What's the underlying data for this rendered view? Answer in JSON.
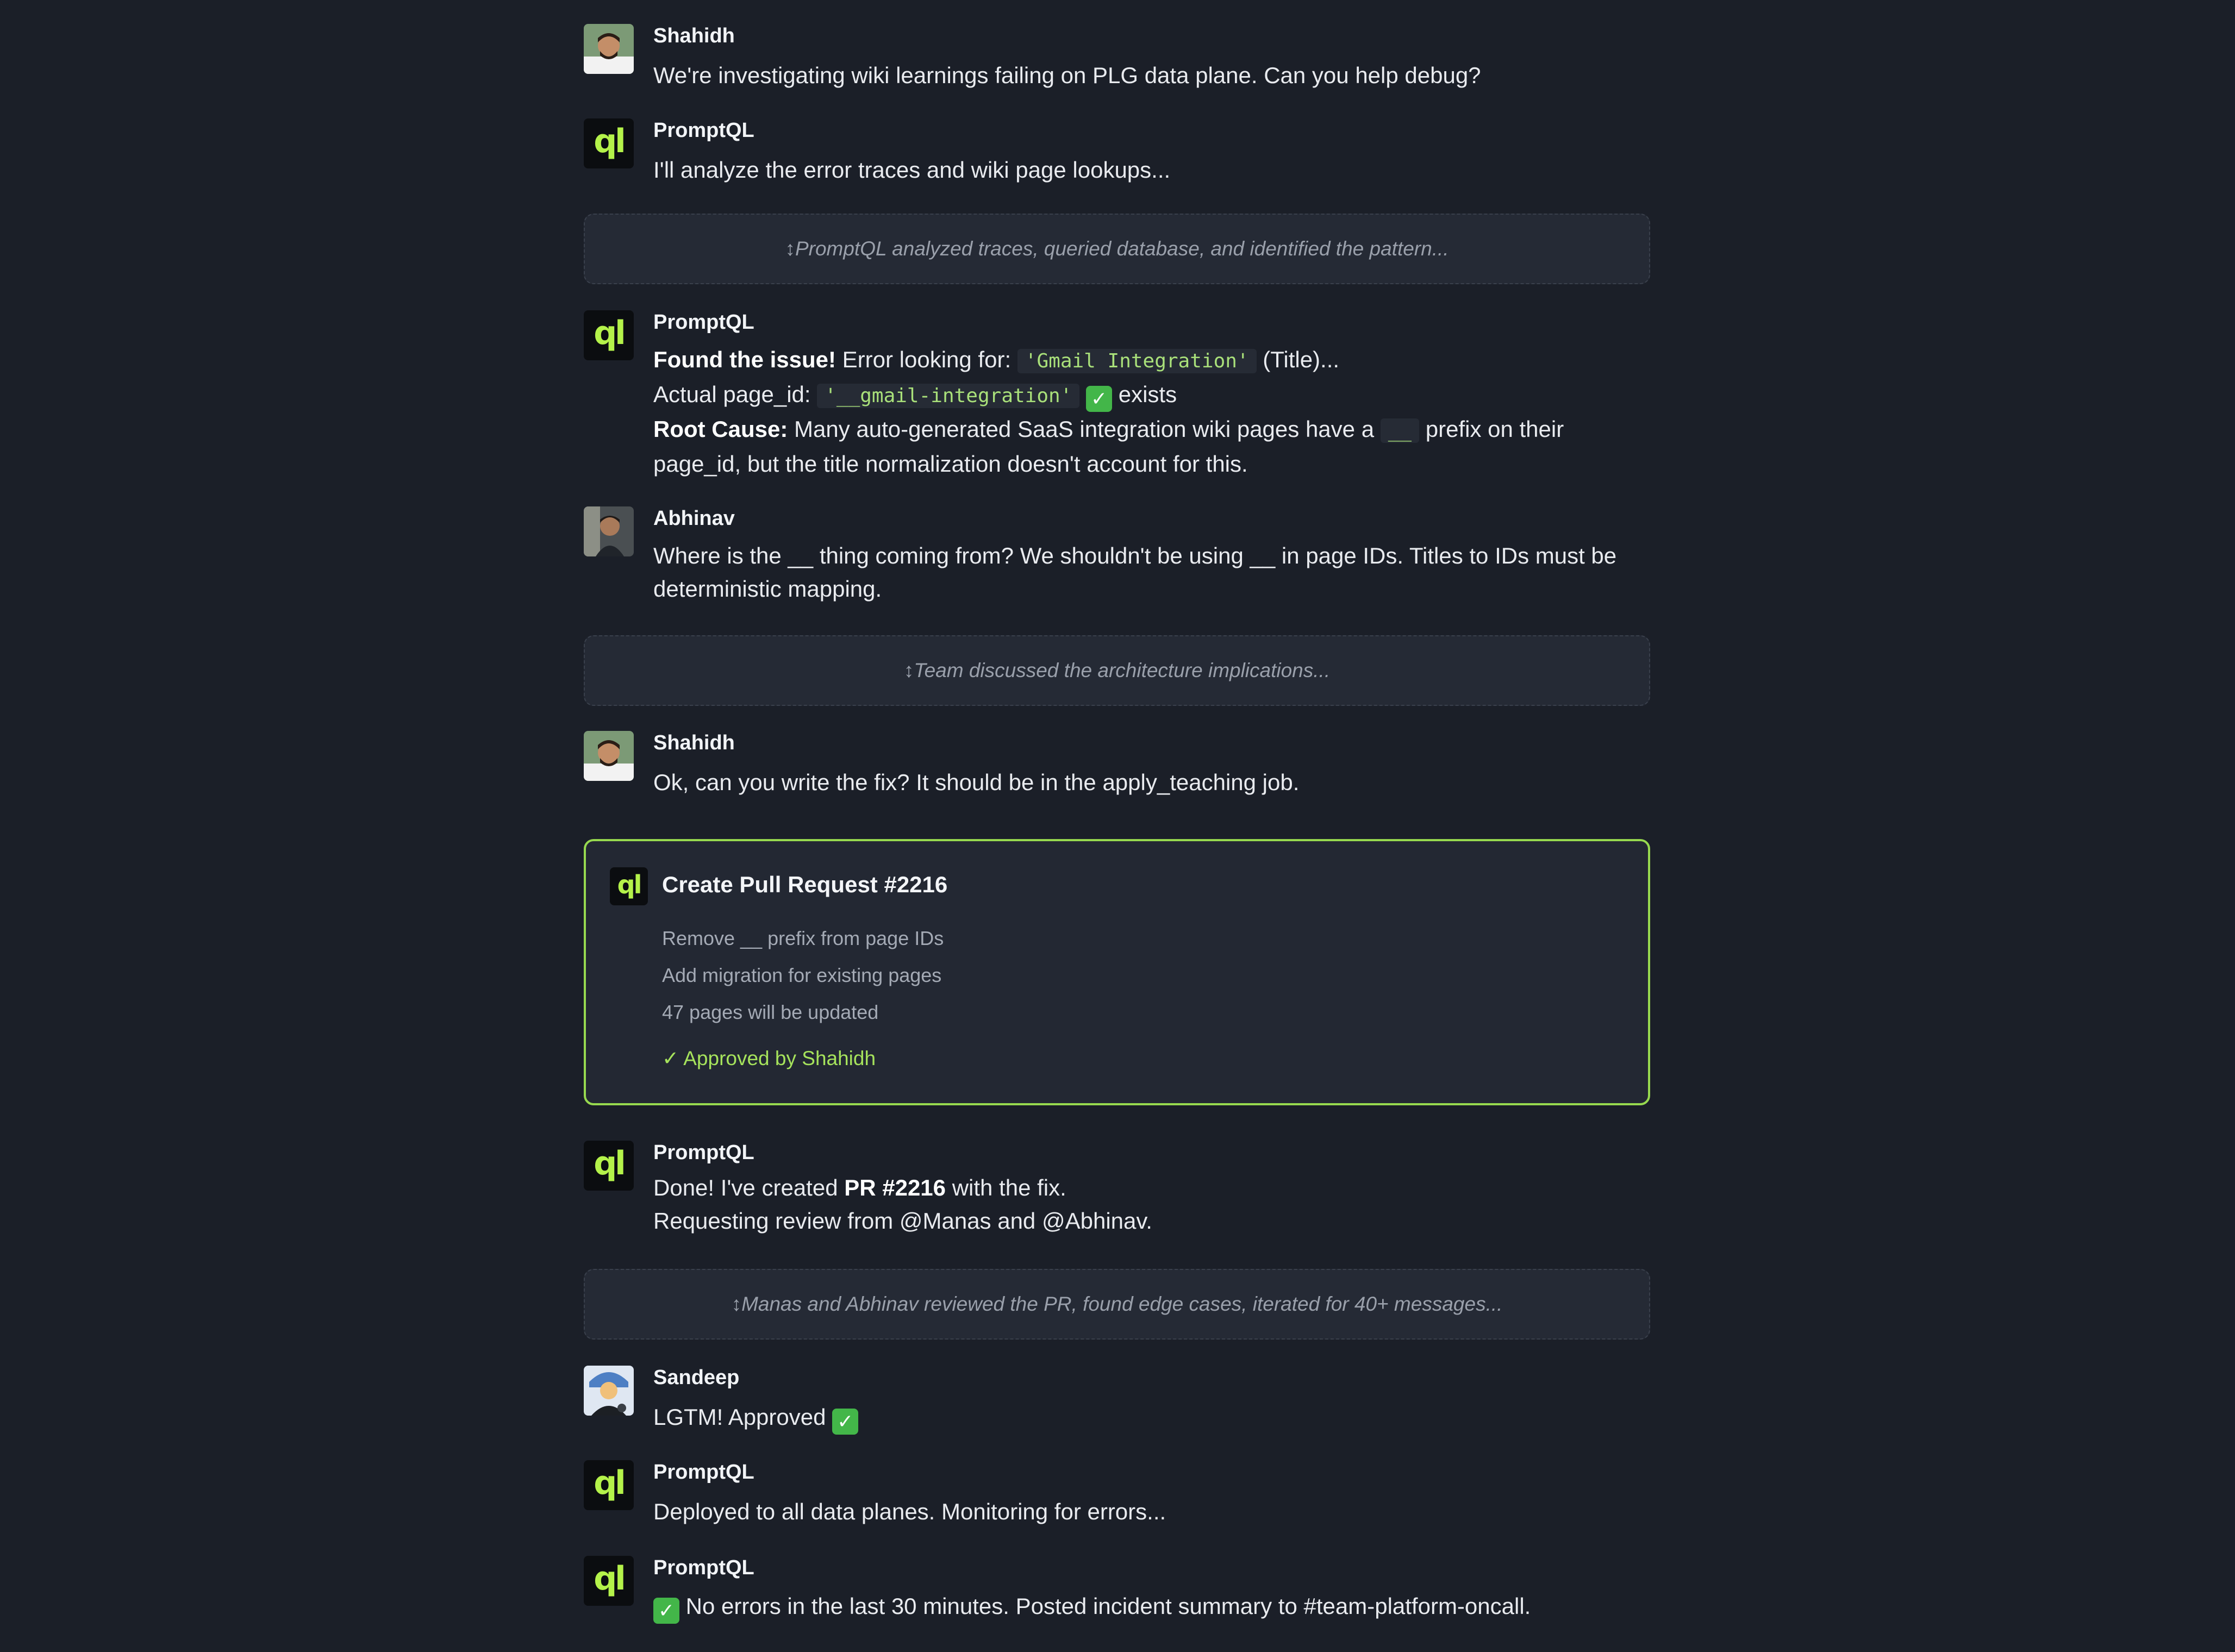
{
  "messages": {
    "m1": {
      "author": "Shahidh",
      "text": "We're investigating wiki learnings failing on PLG data plane. Can you help debug?"
    },
    "m2": {
      "author": "PromptQL",
      "text": "I'll analyze the error traces and wiki page lookups..."
    },
    "m3": {
      "author": "PromptQL",
      "found_label": "Found the issue!",
      "found_text": " Error looking for: ",
      "found_code": "'Gmail Integration'",
      "found_suffix": " (Title)...",
      "actual_label": "Actual page_id: ",
      "actual_code": "'__gmail-integration'",
      "actual_suffix": " exists",
      "root_label": "Root Cause:",
      "root_text": " Many auto-generated SaaS integration wiki pages have a ",
      "root_code": "__",
      "root_suffix": " prefix on their",
      "root_line2": "page_id, but the title normalization doesn't account for this."
    },
    "m4": {
      "author": "Abhinav",
      "line1": "Where is the __ thing coming from? We shouldn't be using __ in page IDs. Titles to IDs must be",
      "line2": "deterministic mapping."
    },
    "m5": {
      "author": "Shahidh",
      "text": "Ok, can you write the fix? It should be in the apply_teaching job."
    },
    "m6": {
      "author": "PromptQL",
      "pre": "Done! I've created ",
      "bold": "PR #2216",
      "post": " with the fix.",
      "line2": "Requesting review from @Manas and @Abhinav."
    },
    "m7": {
      "author": "Sandeep",
      "text": "LGTM! Approved "
    },
    "m8": {
      "author": "PromptQL",
      "text": "Deployed to all data planes. Monitoring for errors..."
    },
    "m9": {
      "author": "PromptQL",
      "text": " No errors in the last 30 minutes. Posted incident summary to #team-platform-oncall."
    }
  },
  "dividers": {
    "d1": "↕PromptQL analyzed traces, queried database, and identified the pattern...",
    "d2": "↕Team discussed the architecture implications...",
    "d3": "↕Manas and Abhinav reviewed the PR, found edge cases, iterated for 40+ messages..."
  },
  "pr_card": {
    "logo": "ql",
    "title": "Create Pull Request #2216",
    "items": [
      "Remove __ prefix from page IDs",
      "Add migration for existing pages",
      "47 pages will be updated"
    ],
    "approved": "✓  Approved by Shahidh"
  },
  "logo_text": "ql",
  "check_glyph": "✓",
  "colors": {
    "background": "#1b1f28",
    "accent_green": "#97d94f",
    "check_green": "#43b649",
    "code_text": "#a9e07a"
  },
  "icons": [
    "promptql-logo-icon",
    "check-mark-icon",
    "user-avatar"
  ]
}
